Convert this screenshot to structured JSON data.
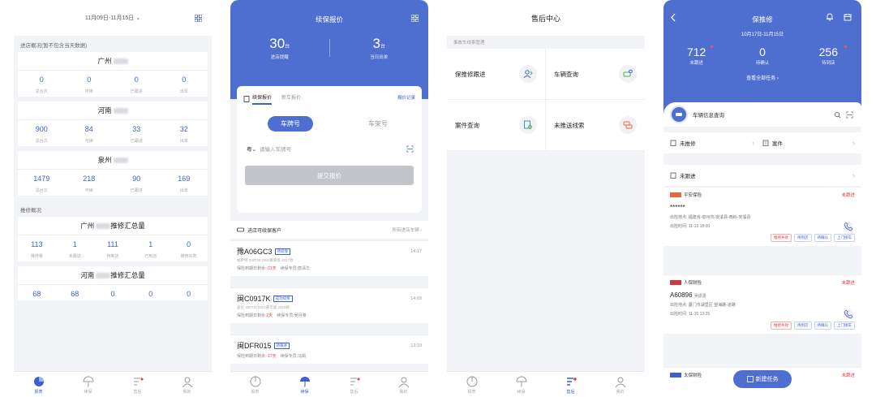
{
  "colors": {
    "primary": "#4f6fd0",
    "accent_red": "#e23c3c",
    "bg": "#f3f4f7"
  },
  "tabbar": [
    {
      "label": "报表",
      "icon": "chart-pie-icon"
    },
    {
      "label": "续保",
      "icon": "umbrella-icon"
    },
    {
      "label": "售后",
      "icon": "wrench-icon"
    },
    {
      "label": "我的",
      "icon": "person-icon"
    }
  ],
  "report": {
    "date_range": "11月09日-11月15日",
    "store_section": "进店概况(暂不包含当天数据)",
    "stores": [
      {
        "city": "广州",
        "values": [
          "0",
          "0",
          "0",
          "0"
        ]
      },
      {
        "city": "河南",
        "values": [
          "900",
          "84",
          "33",
          "32"
        ]
      },
      {
        "city": "泉州",
        "values": [
          "1479",
          "218",
          "90",
          "169"
        ]
      }
    ],
    "store_labels": [
      "总台次",
      "可续",
      "已跟进",
      "出单"
    ],
    "repair_section": "推修概况",
    "repairs": [
      {
        "title_prefix": "广州",
        "title_suffix": "推修汇总量",
        "values": [
          "113",
          "1",
          "111",
          "1",
          "0"
        ]
      },
      {
        "title_prefix": "河南",
        "title_suffix": "推修汇总量",
        "values": [
          "68",
          "68",
          "0",
          "0",
          "0"
        ]
      }
    ],
    "repair_labels": [
      "推修量",
      "未跟进",
      "待到店",
      "已到店",
      "推修失败"
    ]
  },
  "renewal": {
    "title": "续保报价",
    "stat1": {
      "num": "30",
      "unit": "台",
      "desc": "进店提醒"
    },
    "stat2": {
      "num": "3",
      "unit": "台",
      "desc": "当日出单"
    },
    "tab_renew": "续保报价",
    "tab_new": "新车报价",
    "record_link": "报价记录",
    "seg_plate": "车牌号",
    "seg_vin": "车架号",
    "plate_prefix": "粤",
    "plate_placeholder": "请输入车牌号",
    "submit": "提交报价",
    "customers_title": "进店可续保客户",
    "customers_more": "所有进店车辆",
    "cars": [
      {
        "plate": "豫A06GC3",
        "tag": "待续保",
        "time": "14:17",
        "model": "帕萨特 330TSI DSG尊荣版 2017款",
        "days": "-21天",
        "agent": "唐清华"
      },
      {
        "plate": "闽C0917K",
        "tag": "成功续保",
        "time": "14:03",
        "model": "途岳 330TSI DSG豪华版 2019款",
        "days": "2天",
        "agent": "吴月英"
      },
      {
        "plate": "闽DFR015",
        "tag": "待跟进",
        "time": "13:19",
        "model": "",
        "days": "-17天",
        "agent": "冯娟"
      }
    ],
    "exp_label": "保险到期日剩余:",
    "agent_label": "续保专员:"
  },
  "aftersales": {
    "title": "售后中心",
    "section": "事故车线索管理",
    "items": [
      {
        "label": "保推修跟进",
        "icon": "person-follow-icon"
      },
      {
        "label": "车辆查询",
        "icon": "car-search-icon"
      },
      {
        "label": "案件查询",
        "icon": "case-search-icon"
      },
      {
        "label": "未推送线索",
        "icon": "unpushed-lead-icon"
      }
    ]
  },
  "repair": {
    "title": "保推修",
    "date_range": "10月17日-11月15日",
    "stats": [
      {
        "num": "712",
        "desc": "未跟进"
      },
      {
        "num": "0",
        "desc": "待确认"
      },
      {
        "num": "256",
        "desc": "待到店"
      }
    ],
    "view_all": "查看全部任务",
    "vehicle_search": "车辆信息查询",
    "row_untracked": "未推修",
    "row_case": "案件",
    "row_pending": "未跟进",
    "leads": [
      {
        "insurer": "平安保险",
        "status": "未跟进",
        "plate": "******",
        "owner": "",
        "location": "福建省-泉州市-安溪县-西岭-安溪县",
        "time": "11-13 18:00",
        "actions": [
          "推修失败",
          "待到店",
          "待确认",
          "上门接车"
        ]
      },
      {
        "insurer": "人保财险",
        "status": "未跟进",
        "plate": "A60896",
        "owner": "吴振勇",
        "location": "厦门市湖里区 望海路-道路",
        "time": "11-15 13:25",
        "actions": [
          "推修失败",
          "待到店",
          "待确认",
          "上门接车"
        ]
      },
      {
        "insurer": "太保财险",
        "status": "未跟进",
        "plate": "",
        "owner": "",
        "location": "",
        "time": "",
        "actions": []
      }
    ],
    "loc_label": "出险地点:",
    "time_label": "出险时间:",
    "new_task": "新建任务"
  }
}
